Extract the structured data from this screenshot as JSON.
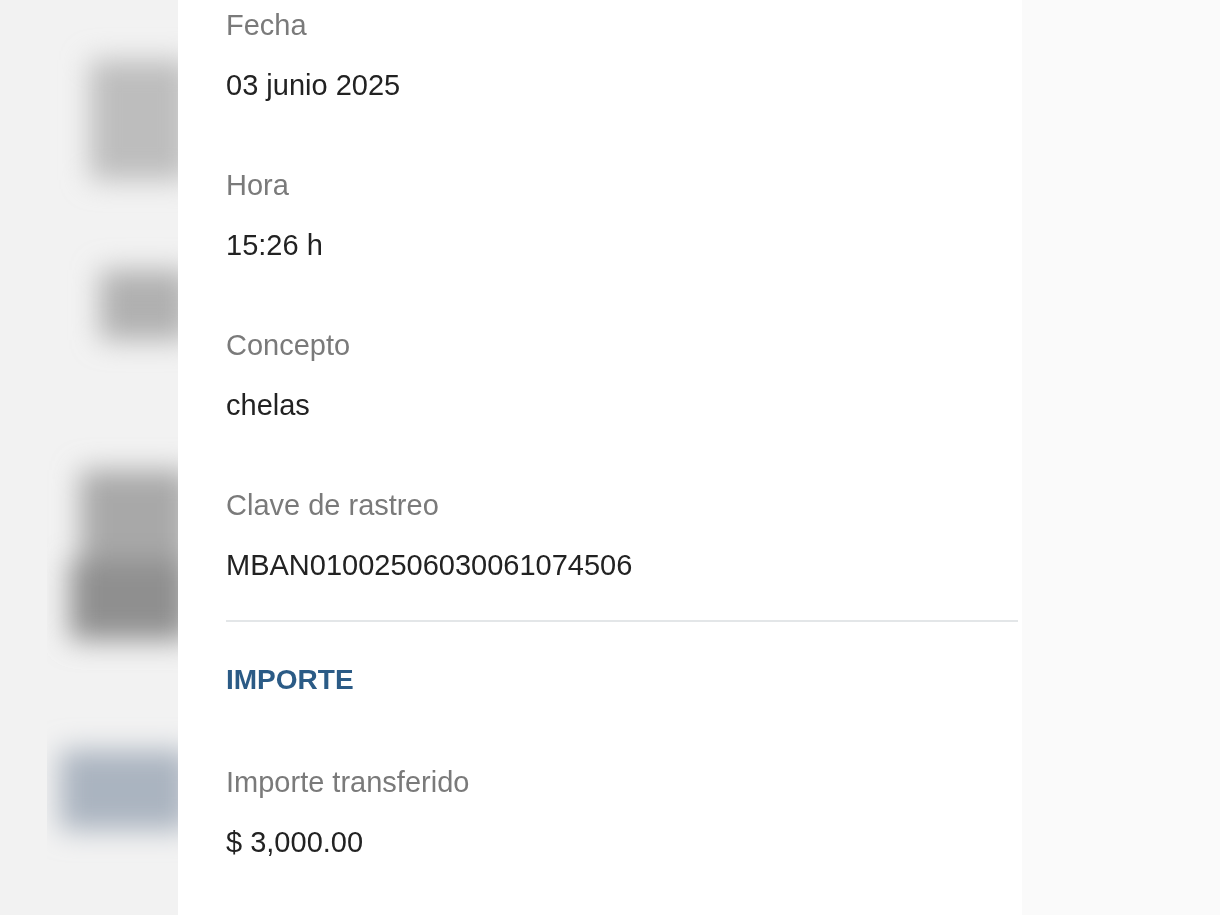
{
  "details": [
    {
      "label": "Fecha",
      "value": "03 junio 2025"
    },
    {
      "label": "Hora",
      "value": "15:26 h"
    },
    {
      "label": "Concepto",
      "value": "chelas"
    },
    {
      "label": "Clave de rastreo",
      "value": "MBAN01002506030061074506"
    }
  ],
  "amount_section": {
    "heading": "IMPORTE",
    "fields": [
      {
        "label": "Importe transferido",
        "value": "$ 3,000.00"
      }
    ]
  }
}
